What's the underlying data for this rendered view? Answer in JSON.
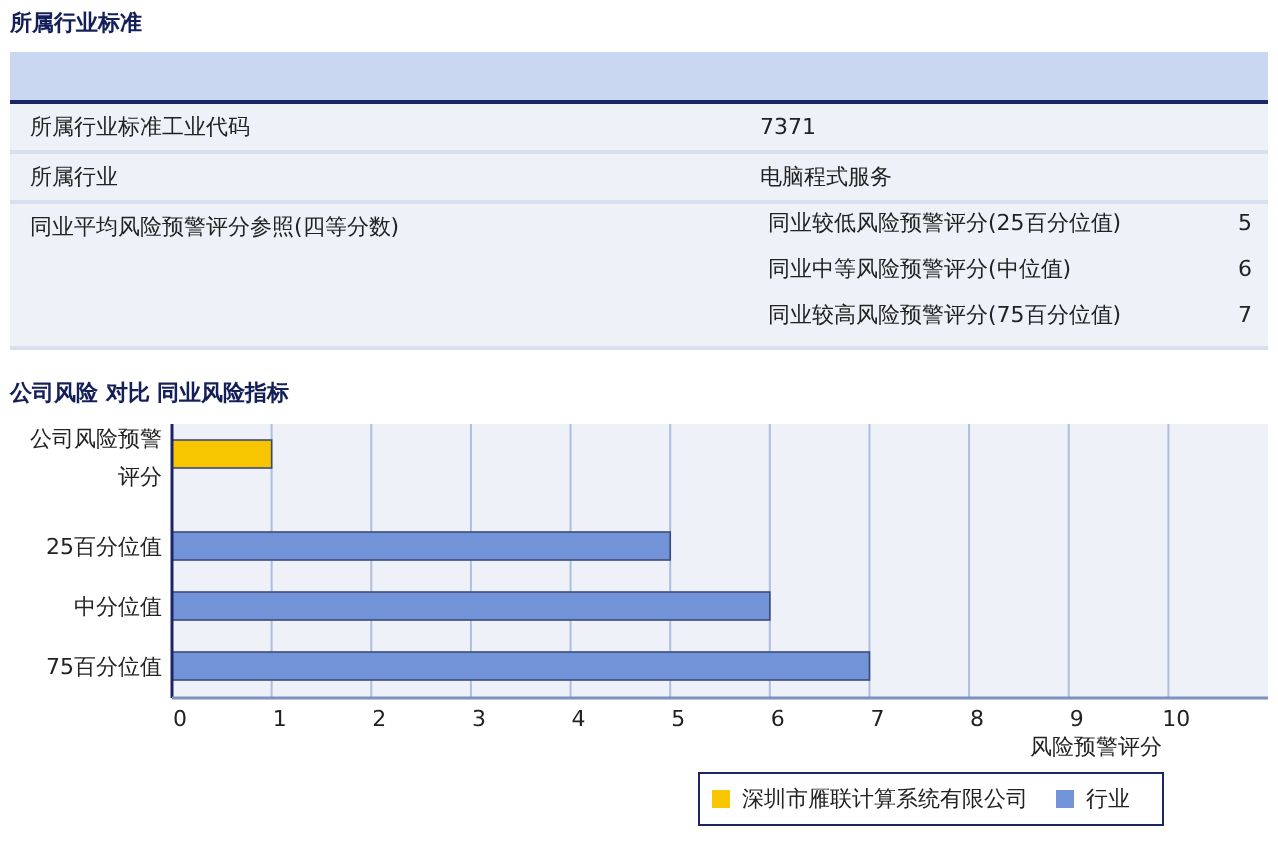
{
  "section_title": "所属行业标准",
  "table": {
    "rows": [
      {
        "label": "所属行业标准工业代码",
        "value": "7371"
      },
      {
        "label": "所属行业",
        "value": "电脑程式服务"
      },
      {
        "label": "同业平均风险预警评分参照(四等分数)",
        "scores": [
          {
            "label": "同业较低风险预警评分(25百分位值)",
            "value": "5"
          },
          {
            "label": "同业中等风险预警评分(中位值)",
            "value": "6"
          },
          {
            "label": "同业较高风险预警评分(75百分位值)",
            "value": "7"
          }
        ]
      }
    ]
  },
  "chart_title": "公司风险 对比 同业风险指标",
  "chart_data": {
    "type": "bar",
    "orientation": "horizontal",
    "xlabel": "风险预警评分",
    "categories": [
      "公司风险预警评分",
      "25百分位值",
      "中分位值",
      "75百分位值"
    ],
    "xlim": [
      0,
      11
    ],
    "grid": true,
    "xticks": [
      {
        "value": 0,
        "label": "0"
      },
      {
        "value": 1,
        "label": "1"
      },
      {
        "value": 2,
        "label": "2"
      },
      {
        "value": 3,
        "label": "3"
      },
      {
        "value": 4,
        "label": "4"
      },
      {
        "value": 5,
        "label": "5"
      },
      {
        "value": 6,
        "label": "6"
      },
      {
        "value": 7,
        "label": "7"
      },
      {
        "value": 8,
        "label": "8"
      },
      {
        "value": 9,
        "label": "9"
      },
      {
        "value": 10,
        "label": "10"
      }
    ],
    "series": [
      {
        "name": "深圳市雁联计算系统有限公司",
        "color": "#f7c600",
        "values": [
          1,
          null,
          null,
          null
        ]
      },
      {
        "name": "行业",
        "color": "#7393d9",
        "values": [
          null,
          5,
          6,
          7
        ]
      }
    ]
  }
}
